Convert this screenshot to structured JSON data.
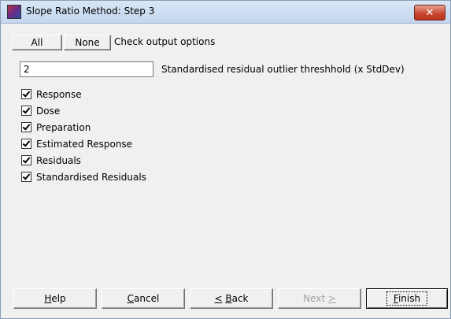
{
  "window": {
    "title": "Slope Ratio Method: Step 3",
    "close_label": "✕"
  },
  "options": {
    "all_label": "All",
    "none_label": "None",
    "check_label": "Check output options"
  },
  "threshold": {
    "value": "2",
    "label": "Standardised residual outlier threshhold (x StdDev)"
  },
  "checkboxes": [
    {
      "label": "Response",
      "checked": true
    },
    {
      "label": "Dose",
      "checked": true
    },
    {
      "label": "Preparation",
      "checked": true
    },
    {
      "label": "Estimated Response",
      "checked": true
    },
    {
      "label": "Residuals",
      "checked": true
    },
    {
      "label": "Standardised Residuals",
      "checked": true
    }
  ],
  "footer": {
    "help": {
      "mnemonic": "H",
      "rest": "elp"
    },
    "cancel": {
      "mnemonic": "C",
      "rest": "ancel"
    },
    "back": {
      "prefix": "< ",
      "mnemonic": "B",
      "rest": "ack",
      "prefix_u": "<"
    },
    "next": {
      "label": "Next",
      "suffix": ">"
    },
    "finish": {
      "mnemonic": "F",
      "rest": "inish"
    }
  }
}
